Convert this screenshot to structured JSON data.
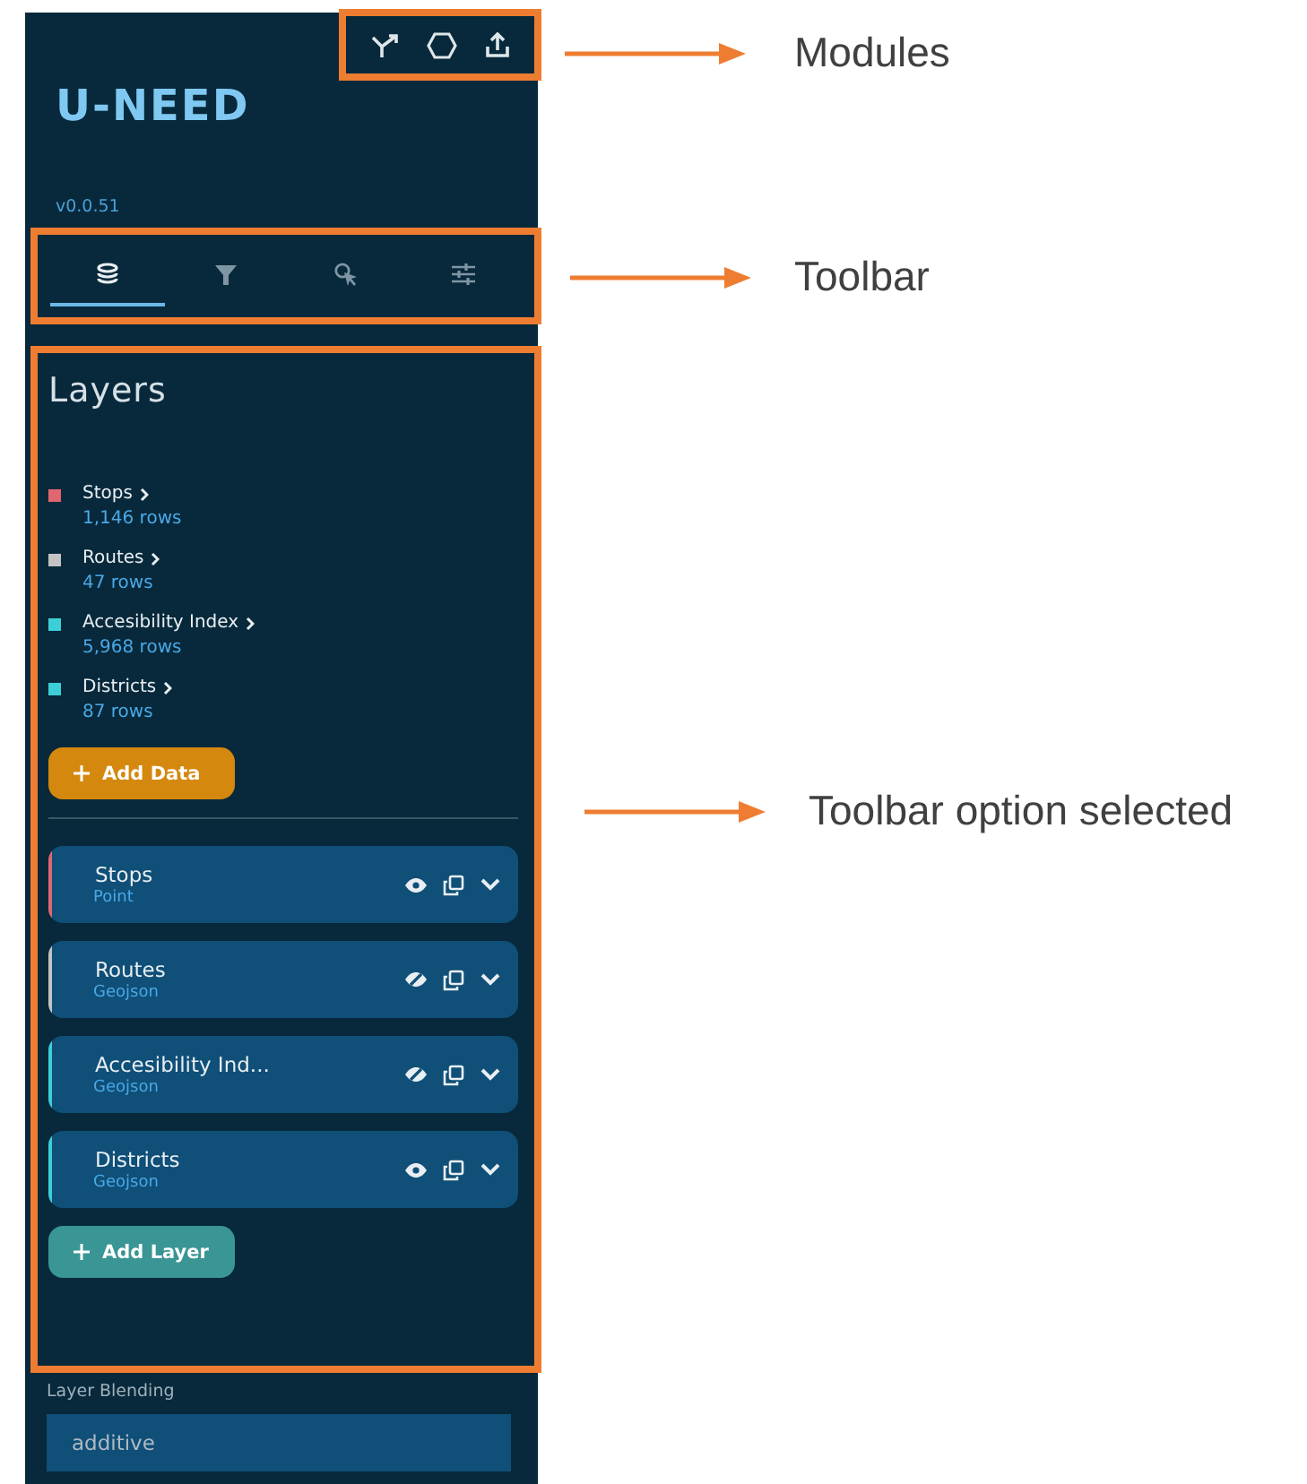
{
  "app": {
    "title": "U-NEED",
    "version": "v0.0.51"
  },
  "toolbar": {
    "tabs": [
      {
        "kind": "layers",
        "selected": true
      },
      {
        "kind": "filter",
        "selected": false
      },
      {
        "kind": "pointer",
        "selected": false
      },
      {
        "kind": "sliders",
        "selected": false
      }
    ]
  },
  "panel": {
    "title": "Layers",
    "datasets": [
      {
        "name": "Stops",
        "rows": "1,146 rows",
        "color": "#e06670"
      },
      {
        "name": "Routes",
        "rows": "47 rows",
        "color": "#c4c4c4"
      },
      {
        "name": "Accesibility Index",
        "rows": "5,968 rows",
        "color": "#3ccfd8"
      },
      {
        "name": "Districts",
        "rows": "87 rows",
        "color": "#3ccfd8"
      }
    ],
    "add_data_button": "Add Data",
    "layers": [
      {
        "name": "Stops",
        "type": "Point",
        "color": "#e06670",
        "visible": true
      },
      {
        "name": "Routes",
        "type": "Geojson",
        "color": "#c4c4c4",
        "visible": false
      },
      {
        "name": "Accesibility Ind...",
        "type": "Geojson",
        "color": "#3ccfd8",
        "visible": false
      },
      {
        "name": "Districts",
        "type": "Geojson",
        "color": "#3ccfd8",
        "visible": true
      }
    ],
    "add_layer_button": "Add Layer",
    "layer_blending": {
      "label": "Layer Blending",
      "value": "additive"
    }
  },
  "annotations": [
    {
      "label": "Modules"
    },
    {
      "label": "Toolbar"
    },
    {
      "label": "Toolbar option selected"
    }
  ]
}
